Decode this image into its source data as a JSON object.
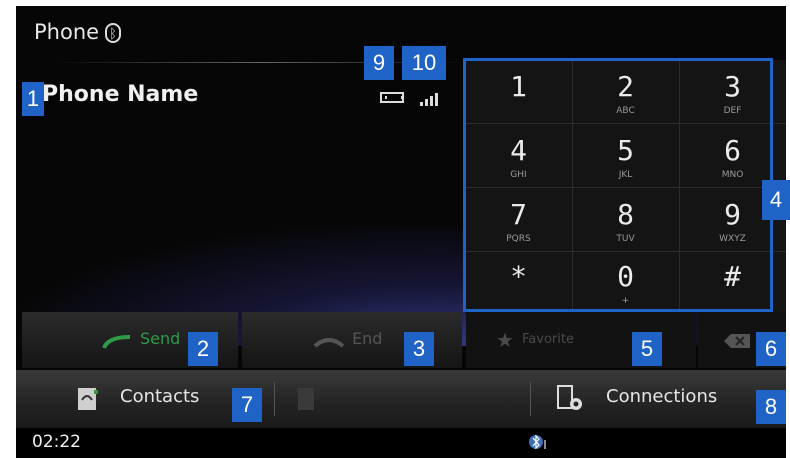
{
  "header": {
    "title": "Phone",
    "bluetooth_icon": "bluetooth-icon"
  },
  "device": {
    "name": "Phone Name",
    "battery_icon": "battery-icon",
    "signal_icon": "signal-icon"
  },
  "keypad": {
    "keys": [
      {
        "digit": "1",
        "letters": ""
      },
      {
        "digit": "2",
        "letters": "ABC"
      },
      {
        "digit": "3",
        "letters": "DEF"
      },
      {
        "digit": "4",
        "letters": "GHI"
      },
      {
        "digit": "5",
        "letters": "JKL"
      },
      {
        "digit": "6",
        "letters": "MNO"
      },
      {
        "digit": "7",
        "letters": "PQRS"
      },
      {
        "digit": "8",
        "letters": "TUV"
      },
      {
        "digit": "9",
        "letters": "WXYZ"
      },
      {
        "digit": "*",
        "letters": ""
      },
      {
        "digit": "0",
        "letters": "+"
      },
      {
        "digit": "#",
        "letters": ""
      }
    ]
  },
  "actions": {
    "send_label": "Send",
    "end_label": "End",
    "favorite_label": "Favorite",
    "send_color": "#2e9a48"
  },
  "tabs": {
    "contacts_label": "Contacts",
    "connections_label": "Connections"
  },
  "statusbar": {
    "time": "02:22"
  },
  "callouts": [
    "1",
    "2",
    "3",
    "4",
    "5",
    "6",
    "7",
    "8",
    "9",
    "10"
  ],
  "colors": {
    "callout": "#1f63c7",
    "keypad_border": "#1f63c7"
  }
}
